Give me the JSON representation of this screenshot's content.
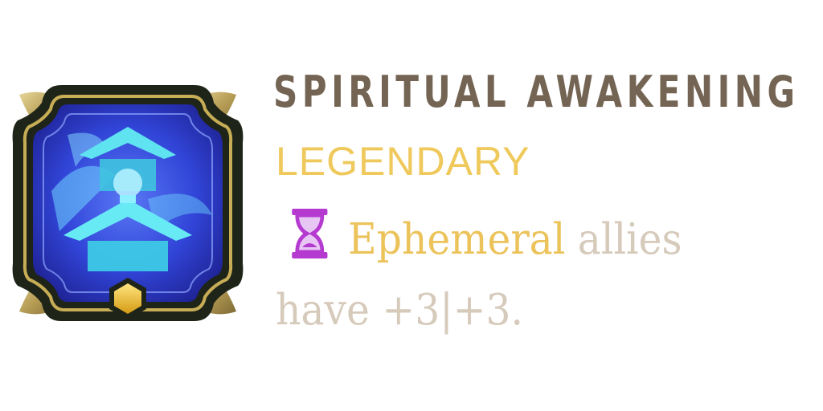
{
  "card": {
    "title": "SPIRITUAL AWAKENING",
    "rarity": "LEGENDARY",
    "description": {
      "keyword": "Ephemeral",
      "text_after_keyword": " allies",
      "line2": "have +3|+3."
    },
    "icons": {
      "badge": "shrine-badge-icon",
      "keyword": "hourglass-icon",
      "gem": "hexagon-gem-icon"
    },
    "colors": {
      "title": "#746453",
      "rarity": "#efc95b",
      "keyword": "#ecc35a",
      "body_text": "#d6cabb",
      "hourglass": "#b43ad0"
    }
  }
}
